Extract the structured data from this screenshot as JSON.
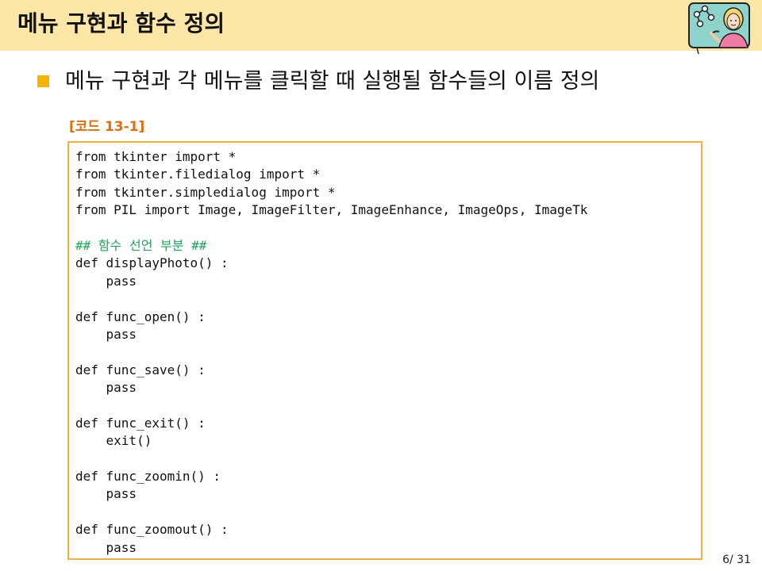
{
  "slide": {
    "title": "메뉴 구현과 함수 정의",
    "bullet": "메뉴 구현과 각 메뉴를 클릭할 때 실행될 함수들의 이름 정의",
    "code_caption": "[코드 13-1]",
    "page_number": "6/ 31"
  },
  "code": {
    "lines": [
      "from tkinter import *",
      "from tkinter.filedialog import *",
      "from tkinter.simpledialog import *",
      "from PIL import Image, ImageFilter, ImageEnhance, ImageOps, ImageTk",
      "",
      "## 함수 선언 부분 ##",
      "def displayPhoto() :",
      "    pass",
      "",
      "def func_open() :",
      "    pass",
      "",
      "def func_save() :",
      "    pass",
      "",
      "def func_exit() :",
      "    exit()",
      "",
      "def func_zoomin() :",
      "    pass",
      "",
      "def func_zoomout() :",
      "    pass"
    ]
  },
  "colors": {
    "header_bg": "#fde7a7",
    "bullet": "#f6b400",
    "caption": "#e46c0a",
    "code_border": "#f4b142",
    "comment": "#1ba85a"
  },
  "icons": {
    "header_illustration": "presenter-woman-network-icon"
  }
}
